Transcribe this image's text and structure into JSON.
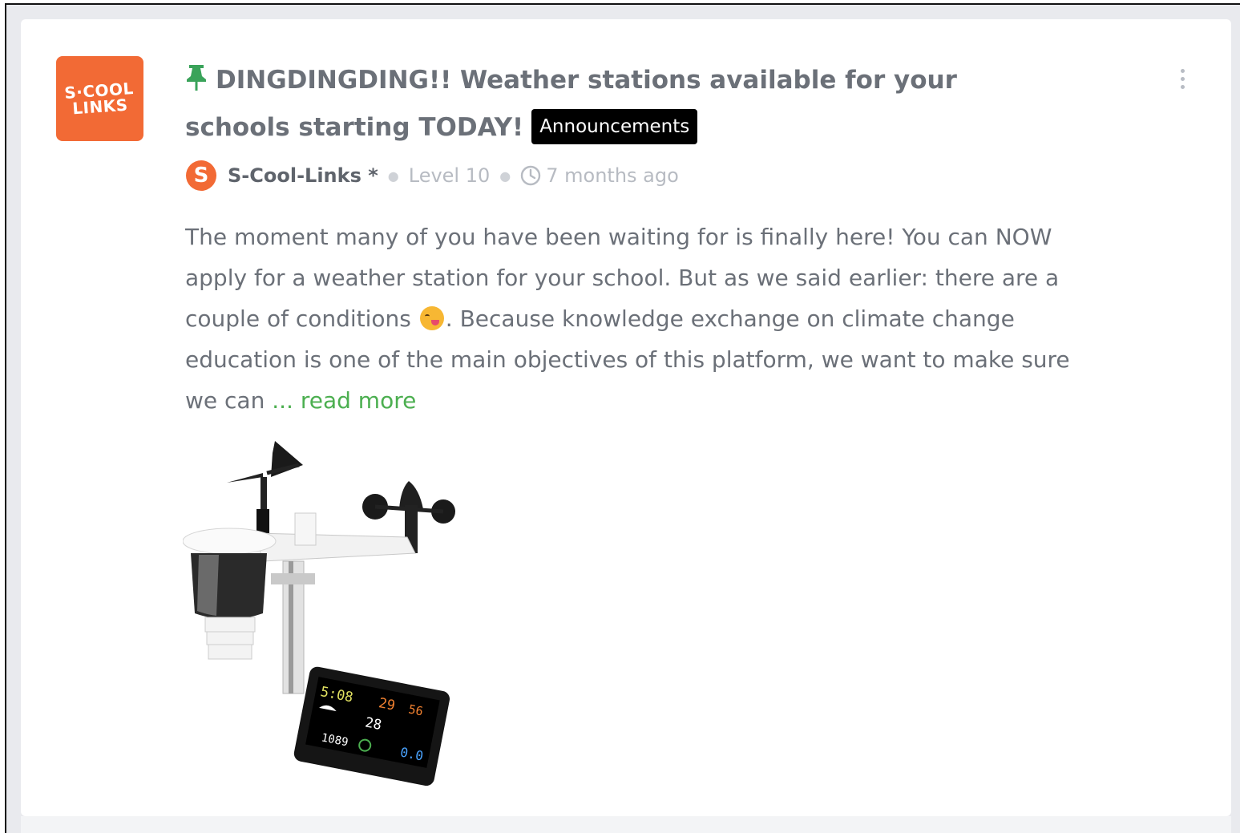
{
  "post": {
    "logo_text": "S-COOL\nLINKS",
    "title": "DINGDINGDING!! Weather stations available for your schools starting TODAY!",
    "category_badge": "Announcements",
    "author": {
      "avatar_letter": "S",
      "name": "S-Cool-Links *",
      "level": "Level 10",
      "time": "7 months ago"
    },
    "excerpt_part1": "The moment many of you have been waiting for is finally here! You can NOW apply for a weather station for your school. But as we said earlier: there are  a couple of conditions",
    "excerpt_part2": ". Because knowledge exchange on climate change education is one of the main objectives of this platform, we want to make sure we can ",
    "read_more": "... read more",
    "image_alt": "weather station",
    "display": {
      "row1_left": "5:08",
      "row1_mid": "29",
      "row1_right": "56",
      "row2_mid": "28",
      "row3_left": "1089",
      "row3_right": "0.0"
    }
  },
  "colors": {
    "brand_orange": "#f26a35",
    "pin_green": "#3aa35a",
    "link_green": "#4caf50",
    "badge_bg": "#000000"
  },
  "icons": [
    "pin-icon",
    "kebab-menu-icon",
    "clock-icon",
    "emoji-icon"
  ]
}
